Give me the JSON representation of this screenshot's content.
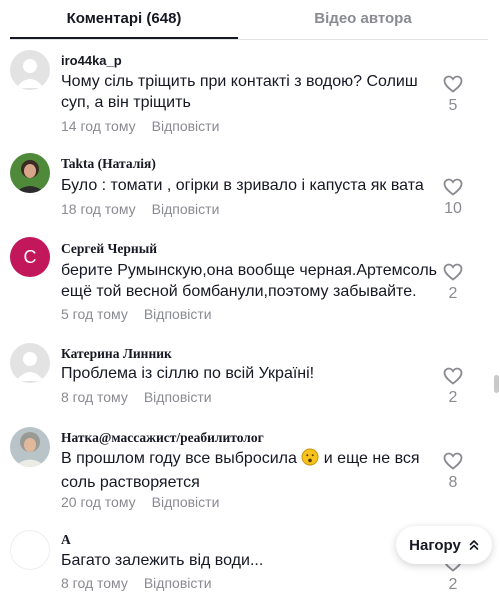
{
  "tabs": {
    "comments_label": "Коментарі (648)",
    "video_label": "Відео автора"
  },
  "reply_label": "Відповісти",
  "comments": [
    {
      "username": "iro44ka_p",
      "text": "Чому сіль тріщить при контакті з водою? Солиш суп, а він тріщить",
      "time": "14 год тому",
      "likes": "5",
      "avatar": "default-avatar-icon"
    },
    {
      "username": "Takta (Наталія)",
      "text": "Було : томати , огірки в зривало і капуста як вата",
      "time": "18 год тому",
      "likes": "10",
      "avatar": "user-photo-avatar"
    },
    {
      "username": "Сергей Черный",
      "text": "берите Румынскую,она вообще черная.Артемсоль ещё той весной бомбанули,поэтому забывайте.",
      "time": "5 год тому",
      "likes": "2",
      "avatar_letter": "С",
      "avatar_color": "#c2185b"
    },
    {
      "username": "Катерина Линник",
      "text": "Проблема із сіллю по всій Україні!",
      "time": "8 год тому",
      "likes": "2",
      "avatar": "default-avatar-icon"
    },
    {
      "username": "Натка@массажист/реабилитолог",
      "text_before_emoji": "В прошлом году все выбросила",
      "text_after_emoji": " и еще не вся соль растворяется",
      "time": "20 год тому",
      "likes": "8",
      "avatar": "user-photo-avatar"
    },
    {
      "username": "А",
      "text": "Багато залежить від води...",
      "time": "8 год тому",
      "likes": "2",
      "avatar": "blank-avatar"
    }
  ],
  "top_button": {
    "label": "Нагору",
    "icon": "double-chevron-up-icon"
  }
}
